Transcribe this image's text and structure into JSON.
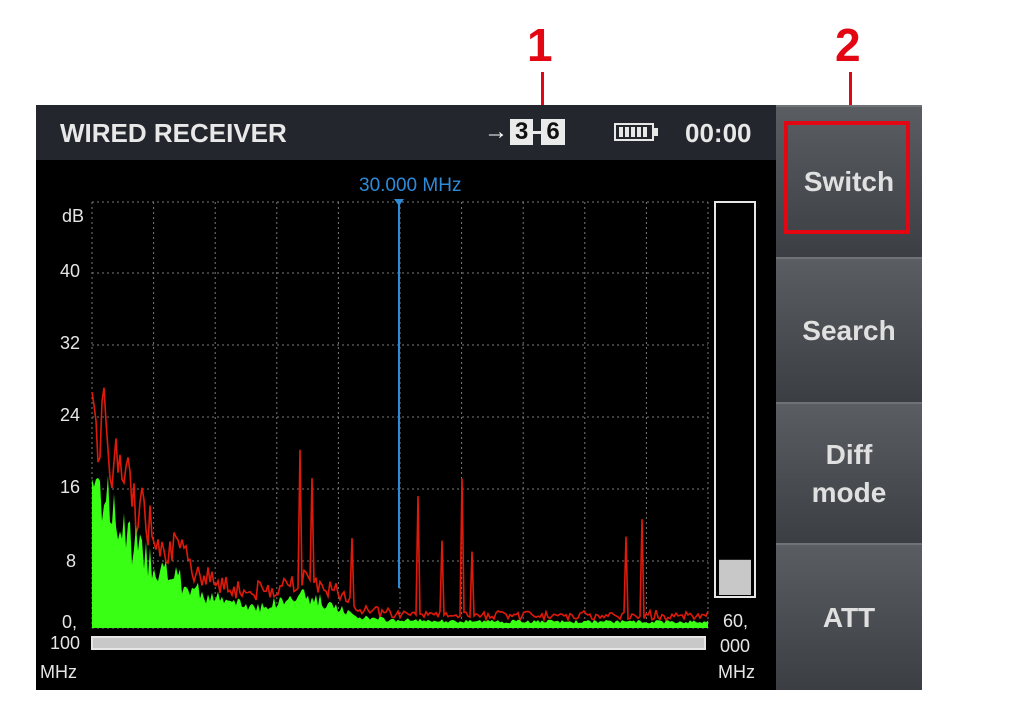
{
  "callouts": [
    "1",
    "2"
  ],
  "status_bar": {
    "title": "WIRED RECEIVER",
    "channel_from": "3",
    "channel_to": "6",
    "time": "00:00"
  },
  "softkeys": [
    "Switch",
    "Search",
    "Diff\nmode",
    "ATT"
  ],
  "spectrum": {
    "marker_label": "30.000 MHz",
    "y_unit": "dB",
    "y_ticks": [
      "40",
      "32",
      "24",
      "16",
      "8",
      "0,"
    ],
    "x_start": [
      "100",
      "MHz"
    ],
    "x_end": [
      "60,",
      "000",
      "MHz"
    ],
    "level_meter": 0.09,
    "colors": {
      "fill": "#39ff14",
      "peak": "#e01a0a",
      "marker": "#2e8bd8"
    }
  }
}
